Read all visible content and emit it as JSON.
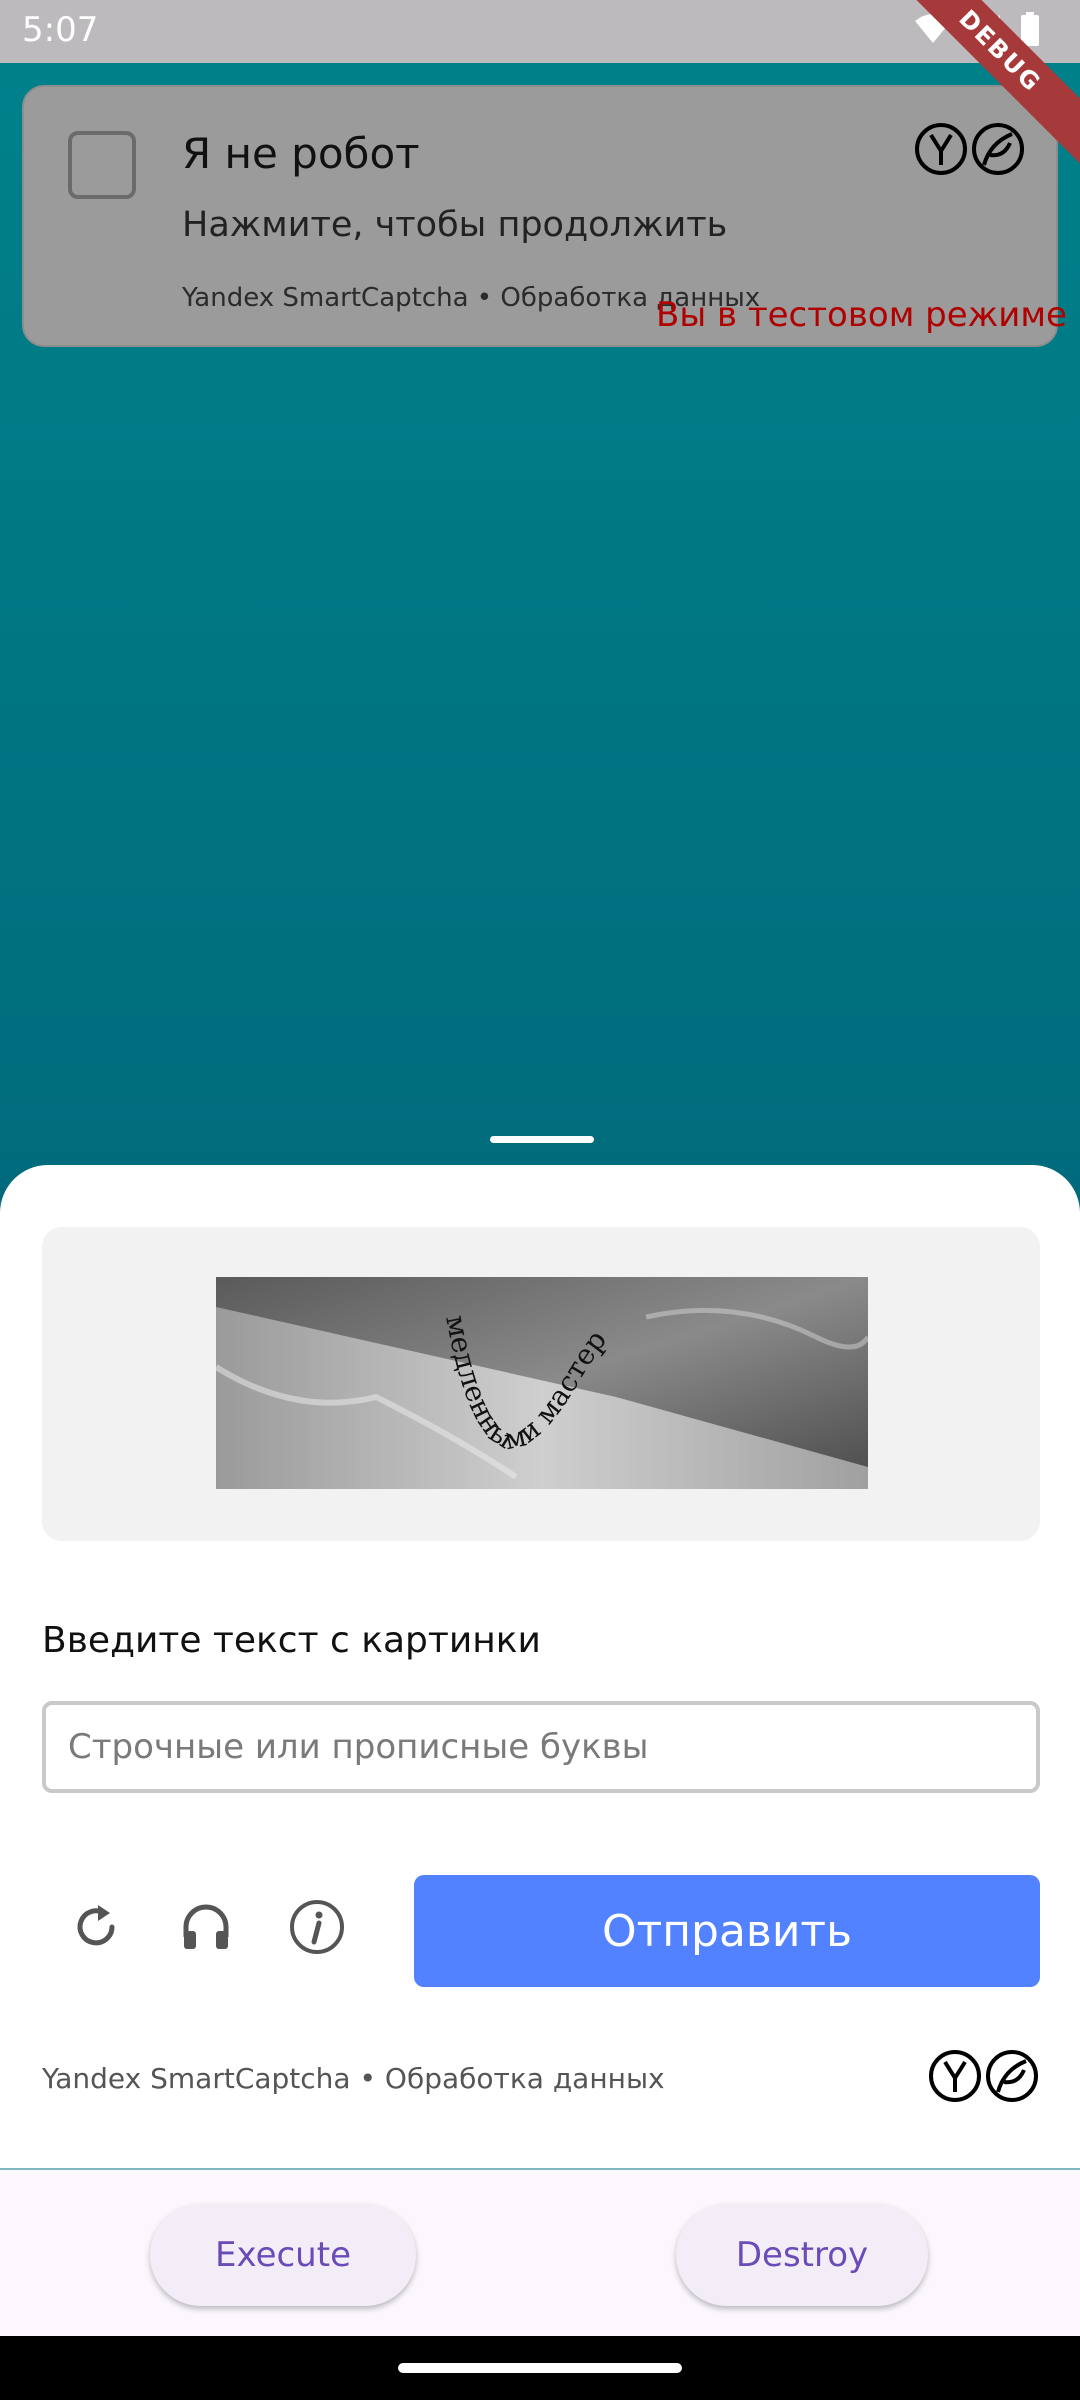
{
  "status_bar": {
    "time": "5:07",
    "debug_label": "DEBUG"
  },
  "captcha_widget": {
    "title": "Я не робот",
    "subtitle": "Нажмите, чтобы продолжить",
    "footer": "Yandex SmartCaptcha • Обработка данных",
    "test_mode": "Вы в тестовом режиме"
  },
  "challenge": {
    "image_text": "медленными мастер",
    "prompt": "Введите текст с картинки",
    "input_placeholder": "Строчные или прописные буквы",
    "input_value": "",
    "submit_label": "Отправить",
    "footer": "Yandex SmartCaptcha • Обработка данных"
  },
  "actions": {
    "execute_label": "Execute",
    "destroy_label": "Destroy"
  },
  "colors": {
    "accent": "#5282ff",
    "background": "#006a7c",
    "test_mode": "#b00000",
    "action_text": "#6a4bb8"
  },
  "icons": [
    "wifi-icon",
    "signal-icon",
    "battery-icon",
    "refresh-icon",
    "headphones-icon",
    "info-icon",
    "yandex-logo-icon"
  ]
}
